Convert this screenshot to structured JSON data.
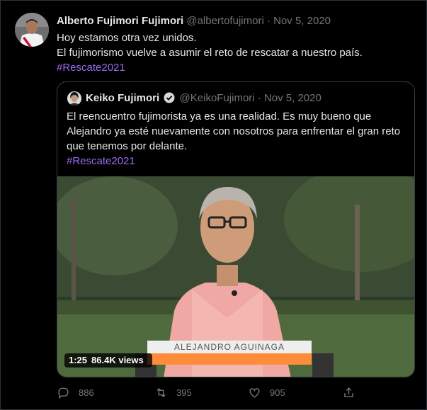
{
  "tweet": {
    "author_name": "Alberto Fujimori Fujimori",
    "handle": "@albertofujimori",
    "separator": " · ",
    "date": "Nov 5, 2020",
    "lines": [
      "Hoy estamos otra vez unidos.",
      "El fujimorismo vuelve a asumir el reto de rescatar a nuestro país."
    ],
    "hashtag": "#Rescate2021"
  },
  "quoted": {
    "author_name": "Keiko Fujimori",
    "handle": "@KeikoFujimori",
    "separator": " · ",
    "date": "Nov 5, 2020",
    "lines": [
      "El reencuentro fujimorista ya es una realidad. Es muy bueno que",
      "Alejandro ya esté nuevamente con nosotros para enfrentar el gran reto",
      "que tenemos por delante."
    ],
    "hashtag": "#Rescate2021",
    "video": {
      "duration": "1:25",
      "views": "86.4K views",
      "caption": "ALEJANDRO AGUINAGA"
    }
  },
  "actions": {
    "replies": "886",
    "retweets": "395",
    "likes": "905"
  },
  "colors": {
    "hashtag": "#9b6cf0",
    "background": "#000000",
    "muted": "#71767b",
    "verified": "#1d9bf0",
    "lower_third_bar": "#ff8c3a"
  },
  "icons": {
    "verified": "verified-badge-icon",
    "reply": "reply-icon",
    "retweet": "retweet-icon",
    "like": "heart-icon",
    "share": "share-icon"
  }
}
